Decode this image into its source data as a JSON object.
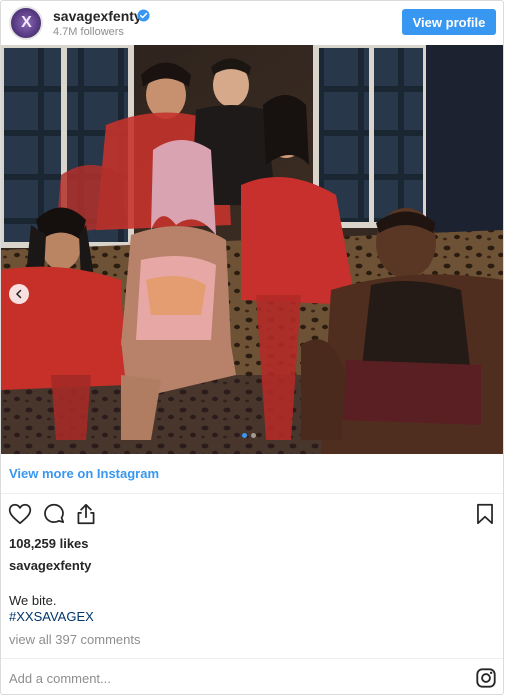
{
  "header": {
    "username": "savagexfenty",
    "followers": "4.7M followers",
    "view_profile_label": "View profile",
    "verified": true
  },
  "carousel": {
    "slide_count": 2,
    "active_slide": 1
  },
  "view_more_label": "View more on Instagram",
  "likes": "108,259 likes",
  "caption": {
    "username": "savagexfenty",
    "text": "We bite.",
    "hashtag": "#XXSAVAGEX"
  },
  "comments_link": "view all 397 comments",
  "comment_placeholder": "Add a comment...",
  "colors": {
    "accent_blue": "#3897f0",
    "hashtag_blue": "#003569",
    "muted_gray": "#8e8e8e"
  },
  "icons": [
    "heart-icon",
    "comment-icon",
    "share-icon",
    "bookmark-icon",
    "instagram-icon",
    "verified-badge-icon",
    "chevron-left-icon"
  ]
}
